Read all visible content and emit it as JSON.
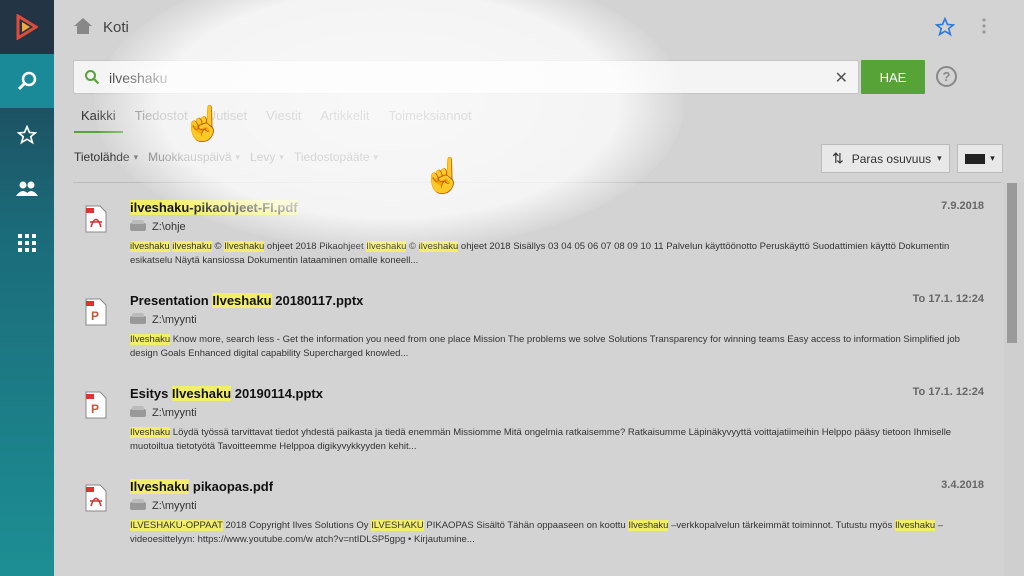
{
  "header": {
    "title": "Koti"
  },
  "search": {
    "value": "ilveshaku",
    "button_label": "HAE",
    "help_label": "?"
  },
  "tabs": [
    {
      "label": "Kaikki",
      "active": true
    },
    {
      "label": "Tiedostot"
    },
    {
      "label": "Uutiset"
    },
    {
      "label": "Viestit"
    },
    {
      "label": "Artikkelit"
    },
    {
      "label": "Toimeksiannot"
    }
  ],
  "filters": [
    "Tietolähde",
    "Muokkauspäivä",
    "Levy",
    "Tiedostopääte"
  ],
  "sort": {
    "label": "Paras osuvuus"
  },
  "results": [
    {
      "title_hl": "ilveshaku-pikaohjeet-FI.pdf",
      "title_pre": "",
      "title_post": "",
      "type": "pdf",
      "date": "7.9.2018",
      "path": "Z:\\ohje",
      "snippet_parts": [
        {
          "t": "ilveshaku",
          "h": true
        },
        {
          "t": " ",
          "h": false
        },
        {
          "t": "ilveshaku",
          "h": true
        },
        {
          "t": " © ",
          "h": false
        },
        {
          "t": "Ilveshaku",
          "h": true
        },
        {
          "t": " ohjeet 2018 Pikaohjeet ",
          "h": false
        },
        {
          "t": "Ilveshaku",
          "h": true
        },
        {
          "t": " © ",
          "h": false
        },
        {
          "t": "ilveshaku",
          "h": true
        },
        {
          "t": " ohjeet 2018 Sisällys 03 04 05 06 07 08 09 10 11 Palvelun käyttöönotto Peruskäyttö Suodattimien käyttö Dokumentin esikatselu Näytä kansiossa Dokumentin lataaminen omalle koneell...",
          "h": false
        }
      ]
    },
    {
      "title_pre": "Presentation ",
      "title_hl": "Ilveshaku",
      "title_post": " 20180117.pptx",
      "type": "pptx",
      "date": "To 17.1. 12:24",
      "path": "Z:\\myynti",
      "snippet_parts": [
        {
          "t": "Ilveshaku",
          "h": true
        },
        {
          "t": " Know more, search less - Get the information you need from one place Mission The problems we solve Solutions Transparency for winning teams Easy access to information Simplified job design Goals Enhanced digital capability Supercharged knowled...",
          "h": false
        }
      ]
    },
    {
      "title_pre": "Esitys ",
      "title_hl": "Ilveshaku",
      "title_post": " 20190114.pptx",
      "type": "pptx",
      "date": "To 17.1. 12:24",
      "path": "Z:\\myynti",
      "snippet_parts": [
        {
          "t": "Ilveshaku",
          "h": true
        },
        {
          "t": " Löydä työssä tarvittavat tiedot yhdestä paikasta ja tiedä enemmän Missiomme Mitä ongelmia ratkaisemme? Ratkaisumme Läpinäkyvyyttä voittajatiimeihin Helppo pääsy tietoon Ihmiselle muotoiltua tietotyötä Tavoitteemme Helppoa digikyvykkyyden kehit...",
          "h": false
        }
      ]
    },
    {
      "title_pre": "",
      "title_hl": "Ilveshaku",
      "title_post": " pikaopas.pdf",
      "type": "pdf",
      "date": "3.4.2018",
      "path": "Z:\\myynti",
      "snippet_parts": [
        {
          "t": "ILVESHAKU-OPPAAT",
          "h": true
        },
        {
          "t": " 2018 Copyright Ilves Solutions Oy ",
          "h": false
        },
        {
          "t": "ILVESHAKU",
          "h": true
        },
        {
          "t": " PIKAOPAS Sisältö Tähän oppaaseen on koottu ",
          "h": false
        },
        {
          "t": "Ilveshaku",
          "h": true
        },
        {
          "t": " –verkkopalvelun tärkeimmät toiminnot. Tutustu myös ",
          "h": false
        },
        {
          "t": "Ilveshaku",
          "h": true
        },
        {
          "t": " – videoesittelyyn: https://www.youtube.com/w atch?v=ntIDLSP5gpg • Kirjautumine...",
          "h": false
        }
      ]
    }
  ],
  "colors": {
    "accent": "#58a337",
    "highlight": "#f2ee69",
    "star": "#2f7bd9"
  }
}
